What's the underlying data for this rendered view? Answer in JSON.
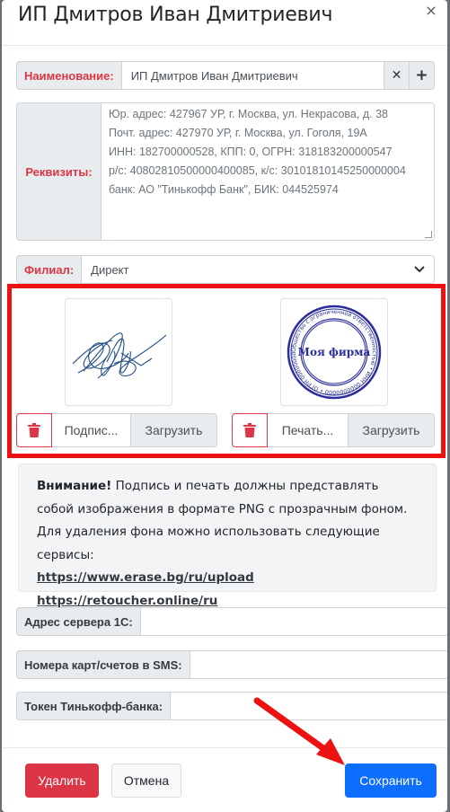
{
  "modal": {
    "title": "ИП Дмитров Иван Дмитриевич",
    "close_glyph": "×"
  },
  "fields": {
    "name": {
      "label": "Наименование:",
      "value": "ИП Дмитров Иван Дмитриевич",
      "clear_glyph": "✕",
      "add_glyph": "+"
    },
    "requisites": {
      "label": "Реквизиты:",
      "value": "Юр. адрес: 427967 УР, г. Москва, ул. Некрасова, д. 38\nПочт. адрес: 427970 УР, г. Москва, ул. Гоголя, 19А\nИНН: 182700000528, КПП: 0, ОГРН: 318183200000547\nр/с: 40802810500000400085, к/с: 30101810145250000004\nбанк: АО \"Тинькофф Банк\", БИК: 044525974"
    },
    "branch": {
      "label": "Филиал:",
      "value": "Директ"
    }
  },
  "uploads": {
    "signature": {
      "file_label": "Подпис...",
      "upload_label": "Загрузить"
    },
    "stamp": {
      "file_label": "Печать...",
      "upload_label": "Загрузить",
      "stamp_text": "Моя фирма",
      "ring_text": "Общество с ограниченной ответственностью • ИНН 0000000000 • ОГРН 0000000000 • Санкт-Петербург"
    }
  },
  "notice": {
    "bold": "Внимание!",
    "text": " Подпись и печать должны представлять собой изображения в формате PNG с прозрачным фоном. Для удаления фона можно использовать следующие сервисы:",
    "links": [
      "https://www.erase.bg/ru/upload",
      "https://retoucher.online/ru"
    ]
  },
  "extra_fields": {
    "server": {
      "label": "Адрес сервера 1С:",
      "value": ""
    },
    "cards": {
      "label": "Номера карт/счетов в SMS:",
      "value": ""
    },
    "token": {
      "label": "Токен Тинькофф-банка:",
      "value": ""
    }
  },
  "footer": {
    "delete_label": "Удалить",
    "cancel_label": "Отмена",
    "save_label": "Сохранить"
  },
  "colors": {
    "annotation_red": "#ee1111",
    "danger": "#dc3545",
    "primary": "#0d6efd",
    "stamp_blue": "#2b2f9b",
    "signature_blue": "#1f4e86"
  },
  "icons": {
    "delete": "trash-icon",
    "dropdown": "chevron-down-icon",
    "close": "close-icon"
  }
}
